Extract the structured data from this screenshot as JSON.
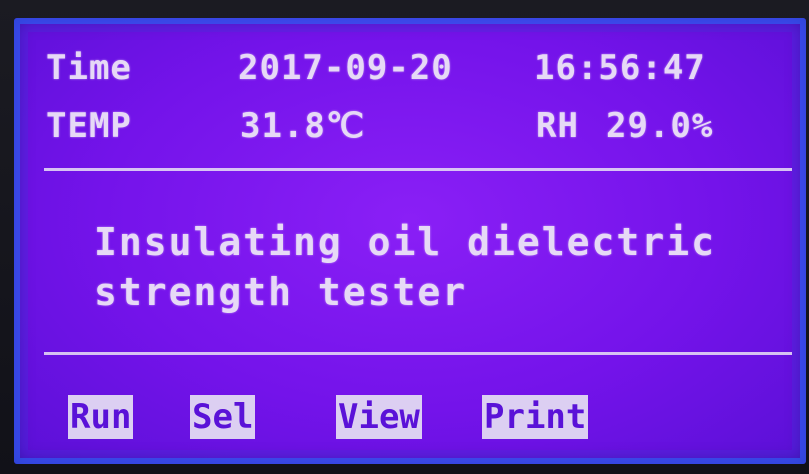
{
  "status": {
    "time_label": "Time",
    "date": "2017-09-20",
    "time": "16:56:47",
    "temp_label": "TEMP",
    "temp_value": "31.8℃",
    "rh_label": "RH",
    "rh_value": "29.0%"
  },
  "main": {
    "title_line1": "Insulating oil dielectric",
    "title_line2": "strength tester"
  },
  "softkeys": {
    "run": "Run",
    "sel": "Sel",
    "view": "View",
    "print": "Print"
  },
  "colors": {
    "screen": "#7a16ee",
    "text": "#e6d9f6",
    "key_bg": "#dccff2",
    "key_text": "#5a12d8"
  }
}
